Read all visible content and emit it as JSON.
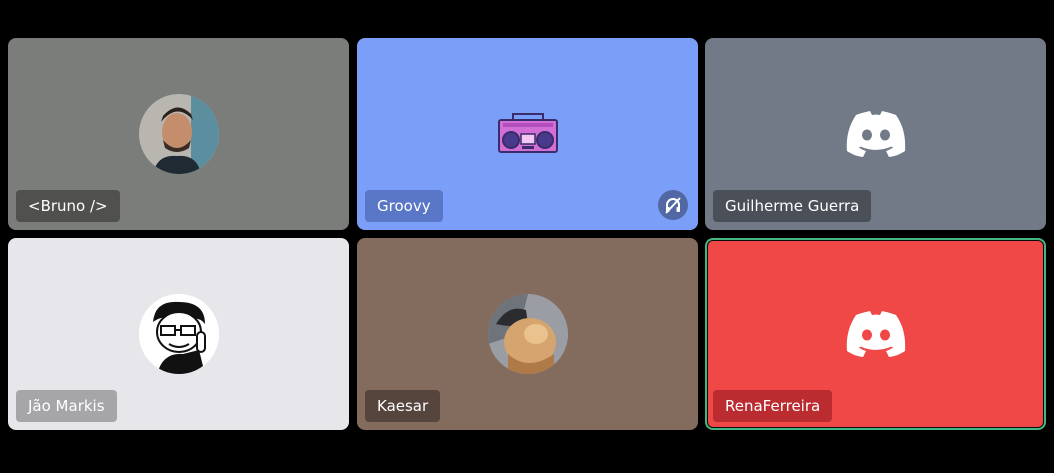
{
  "participants": [
    {
      "name": "<Bruno />",
      "tile_color": "#7b7d7a",
      "avatar": "photo-avatar"
    },
    {
      "name": "Groovy",
      "tile_color": "#7b9ff8",
      "avatar": "boombox-icon",
      "status_icon": "deafened-icon"
    },
    {
      "name": "Guilherme Guerra",
      "tile_color": "#737a87",
      "avatar": "discord-logo-icon"
    },
    {
      "name": "Jão Markis",
      "tile_color": "#e7e6ea",
      "avatar": "cartoon-avatar"
    },
    {
      "name": "Kaesar",
      "tile_color": "#836b5d",
      "avatar": "photo-avatar"
    },
    {
      "name": "RenaFerreira",
      "tile_color": "#f04747",
      "avatar": "discord-logo-icon",
      "speaking": true
    }
  ],
  "colors": {
    "background": "#000000",
    "speaking_ring": "#43b581"
  }
}
